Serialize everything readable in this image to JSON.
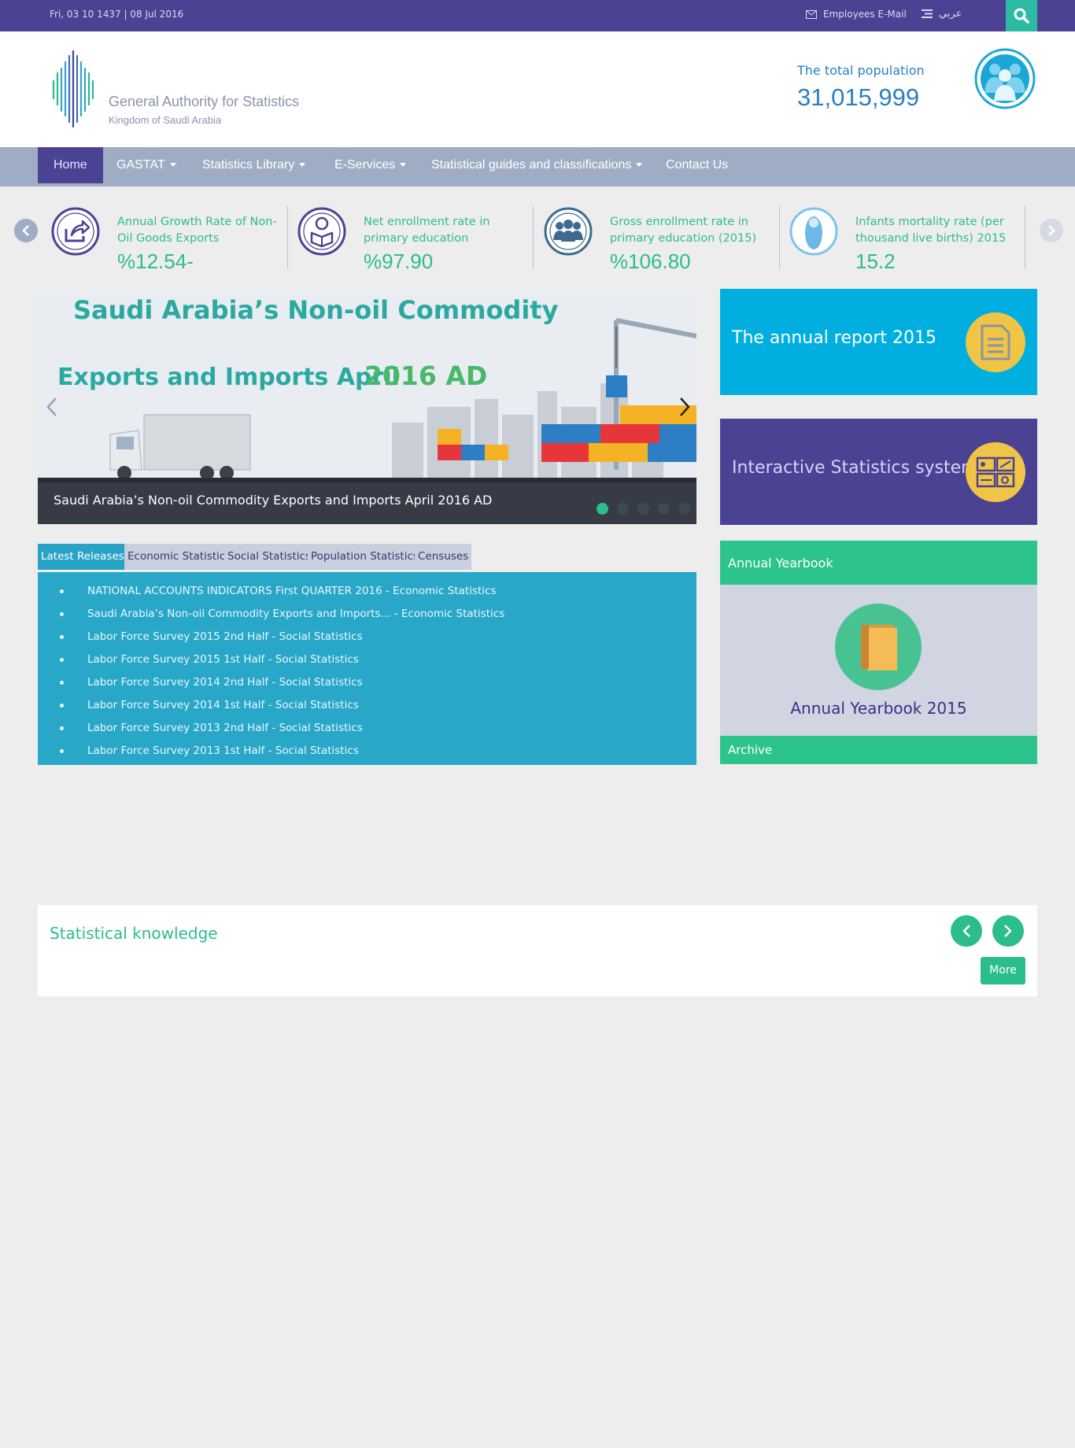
{
  "topbar": {
    "date": "Fri, 03 10 1437 | 08 Jul 2016",
    "employees_mail": "Employees E-Mail",
    "language": "عربي"
  },
  "header": {
    "logo_line1": "General Authority for Statistics",
    "logo_line2": "Kingdom of Saudi Arabia",
    "population_label": "The total population",
    "population_value": "31,015,999"
  },
  "nav": {
    "items": [
      {
        "label": "Home"
      },
      {
        "label": "GASTAT"
      },
      {
        "label": "Statistics Library"
      },
      {
        "label": "E-Services"
      },
      {
        "label": "Statistical guides and classifications"
      },
      {
        "label": "Contact Us"
      }
    ]
  },
  "indicators": [
    {
      "title": "Annual Growth Rate of Non-Oil Goods Exports",
      "value": "%12.54-",
      "icon": "export-arrow-icon"
    },
    {
      "title": "Net enrollment rate in primary education",
      "value": "%97.90",
      "icon": "student-reading-icon"
    },
    {
      "title": "Gross enrollment rate in primary education (2015)",
      "value": "%106.80",
      "icon": "group-people-icon"
    },
    {
      "title": "Infants mortality rate (per thousand live births) 2015",
      "value": "15.2",
      "icon": "infant-icon"
    }
  ],
  "slider": {
    "headline_line1": "Saudi Arabia’s Non-oil Commodity",
    "headline_line2": "Exports and Imports April",
    "headline_year": "2016 AD",
    "caption": "Saudi Arabia’s Non-oil Commodity Exports and Imports April 2016 AD",
    "slide_count": 5,
    "active_slide": 1
  },
  "tiles": {
    "annual_report": "The annual report 2015",
    "interactive": "Interactive Statistics system"
  },
  "yearbook": {
    "heading": "Annual Yearbook",
    "title": "Annual Yearbook 2015",
    "archive": "Archive"
  },
  "tabs": [
    {
      "label": "Latest Releases"
    },
    {
      "label": "Economic Statistics"
    },
    {
      "label": "Social Statistics"
    },
    {
      "label": "Population Statistics"
    },
    {
      "label": "Censuses"
    }
  ],
  "releases": [
    "NATIONAL ACCOUNTS INDICATORS First QUARTER 2016 - Economic Statistics",
    "Saudi Arabia’s Non-oil Commodity Exports and Imports... - Economic Statistics",
    "Labor Force Survey 2015 2nd Half - Social Statistics",
    "Labor Force Survey 2015 1st Half - Social Statistics",
    "Labor Force Survey 2014 2nd Half - Social Statistics",
    "Labor Force Survey 2014 1st Half - Social Statistics",
    "Labor Force Survey 2013 2nd Half - Social Statistics",
    "Labor Force Survey 2013 1st Half - Social Statistics"
  ],
  "knowledge": {
    "title": "Statistical knowledge",
    "more": "More"
  },
  "colors": {
    "brand_purple": "#4b4294",
    "brand_green": "#2bbd8c",
    "nav_bg": "#9fadc4",
    "releases_bg": "#29a7c8",
    "report_tile": "#00afe0",
    "interactive_tile": "#4b4294"
  }
}
